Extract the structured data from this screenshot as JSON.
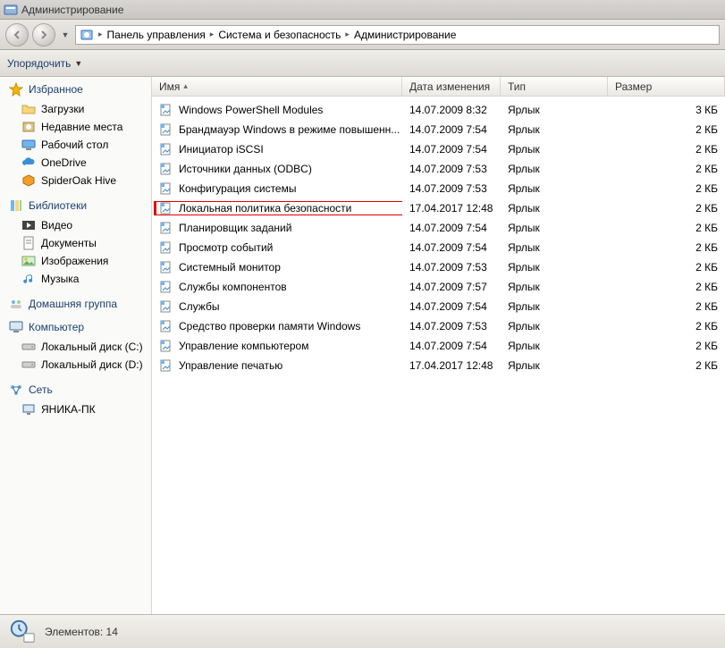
{
  "window": {
    "title": "Администрирование"
  },
  "breadcrumbs": {
    "seg1": "Панель управления",
    "seg2": "Система и безопасность",
    "seg3": "Администрирование"
  },
  "toolbar": {
    "organize": "Упорядочить"
  },
  "sidebar": {
    "favorites": {
      "label": "Избранное",
      "items": [
        {
          "label": "Загрузки"
        },
        {
          "label": "Недавние места"
        },
        {
          "label": "Рабочий стол"
        },
        {
          "label": "OneDrive"
        },
        {
          "label": "SpiderOak Hive"
        }
      ]
    },
    "libraries": {
      "label": "Библиотеки",
      "items": [
        {
          "label": "Видео"
        },
        {
          "label": "Документы"
        },
        {
          "label": "Изображения"
        },
        {
          "label": "Музыка"
        }
      ]
    },
    "homegroup": {
      "label": "Домашняя группа"
    },
    "computer": {
      "label": "Компьютер",
      "items": [
        {
          "label": "Локальный диск (C:)"
        },
        {
          "label": "Локальный диск (D:)"
        }
      ]
    },
    "network": {
      "label": "Сеть",
      "items": [
        {
          "label": "ЯНИКА-ПК"
        }
      ]
    }
  },
  "columns": {
    "name": "Имя",
    "date": "Дата изменения",
    "type": "Тип",
    "size": "Размер"
  },
  "files": [
    {
      "name": "Windows PowerShell Modules",
      "date": "14.07.2009 8:32",
      "type": "Ярлык",
      "size": "3 КБ",
      "highlight": false
    },
    {
      "name": "Брандмауэр Windows в режиме повышенн...",
      "date": "14.07.2009 7:54",
      "type": "Ярлык",
      "size": "2 КБ",
      "highlight": false
    },
    {
      "name": "Инициатор iSCSI",
      "date": "14.07.2009 7:54",
      "type": "Ярлык",
      "size": "2 КБ",
      "highlight": false
    },
    {
      "name": "Источники данных (ODBC)",
      "date": "14.07.2009 7:53",
      "type": "Ярлык",
      "size": "2 КБ",
      "highlight": false
    },
    {
      "name": "Конфигурация системы",
      "date": "14.07.2009 7:53",
      "type": "Ярлык",
      "size": "2 КБ",
      "highlight": false
    },
    {
      "name": "Локальная политика безопасности",
      "date": "17.04.2017 12:48",
      "type": "Ярлык",
      "size": "2 КБ",
      "highlight": true
    },
    {
      "name": "Планировщик заданий",
      "date": "14.07.2009 7:54",
      "type": "Ярлык",
      "size": "2 КБ",
      "highlight": false
    },
    {
      "name": "Просмотр событий",
      "date": "14.07.2009 7:54",
      "type": "Ярлык",
      "size": "2 КБ",
      "highlight": false
    },
    {
      "name": "Системный монитор",
      "date": "14.07.2009 7:53",
      "type": "Ярлык",
      "size": "2 КБ",
      "highlight": false
    },
    {
      "name": "Службы компонентов",
      "date": "14.07.2009 7:57",
      "type": "Ярлык",
      "size": "2 КБ",
      "highlight": false
    },
    {
      "name": "Службы",
      "date": "14.07.2009 7:54",
      "type": "Ярлык",
      "size": "2 КБ",
      "highlight": false
    },
    {
      "name": "Средство проверки памяти Windows",
      "date": "14.07.2009 7:53",
      "type": "Ярлык",
      "size": "2 КБ",
      "highlight": false
    },
    {
      "name": "Управление компьютером",
      "date": "14.07.2009 7:54",
      "type": "Ярлык",
      "size": "2 КБ",
      "highlight": false
    },
    {
      "name": "Управление печатью",
      "date": "17.04.2017 12:48",
      "type": "Ярлык",
      "size": "2 КБ",
      "highlight": false
    }
  ],
  "status": {
    "text": "Элементов: 14"
  }
}
